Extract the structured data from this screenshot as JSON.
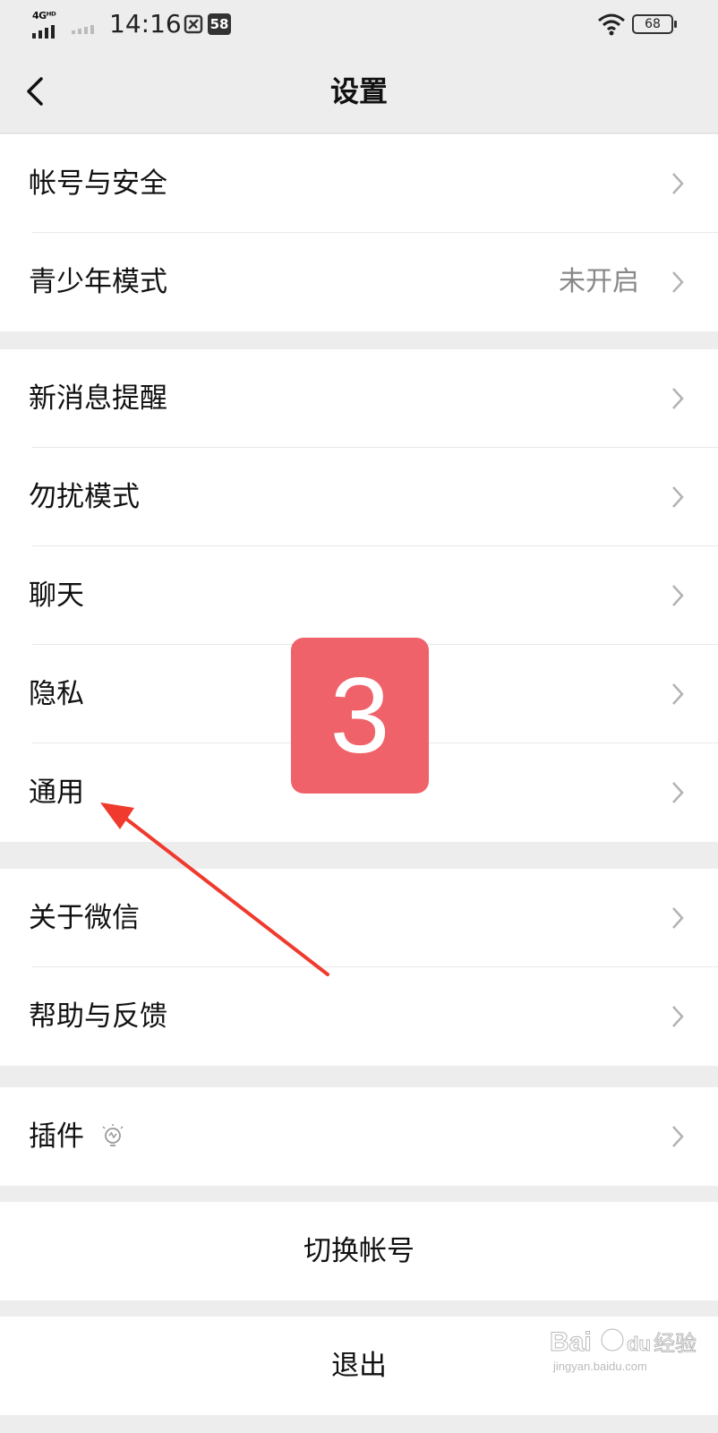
{
  "status_bar": {
    "network": "4Gᴴᴰ",
    "time": "14:16",
    "notification_count": "58",
    "battery": "68"
  },
  "nav": {
    "title": "设置"
  },
  "groups": [
    {
      "items": [
        {
          "label": "帐号与安全"
        },
        {
          "label": "青少年模式",
          "value": "未开启"
        }
      ]
    },
    {
      "items": [
        {
          "label": "新消息提醒"
        },
        {
          "label": "勿扰模式"
        },
        {
          "label": "聊天"
        },
        {
          "label": "隐私"
        },
        {
          "label": "通用"
        }
      ]
    },
    {
      "items": [
        {
          "label": "关于微信"
        },
        {
          "label": "帮助与反馈"
        }
      ]
    },
    {
      "items": [
        {
          "label": "插件",
          "icon": "lightbulb-icon"
        }
      ]
    }
  ],
  "actions": {
    "switch_account": "切换帐号",
    "logout": "退出"
  },
  "annotation": {
    "step_number": "3",
    "badge_color": "#f0626a",
    "arrow_color": "#f03a2e"
  },
  "watermark": {
    "brand": "Bai",
    "brand2": "du",
    "product": "经验",
    "url": "jingyan.baidu.com"
  }
}
